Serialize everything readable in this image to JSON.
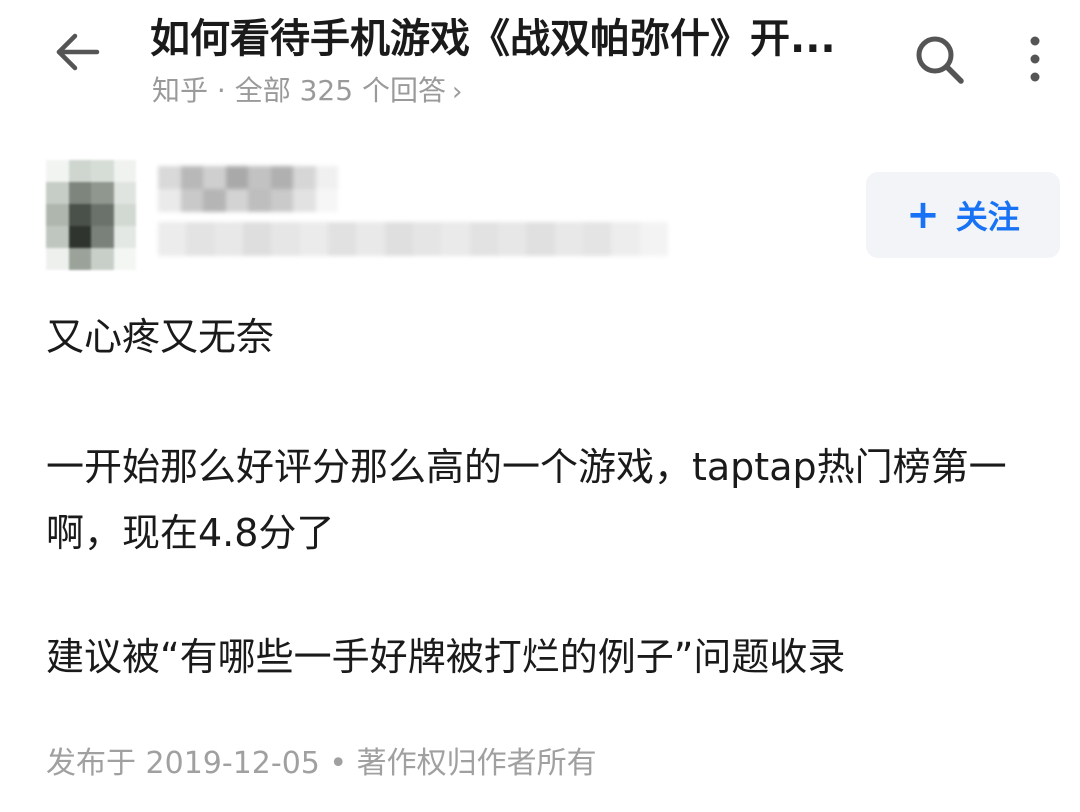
{
  "header": {
    "title": "如何看待手机游戏《战双帕弥什》开...",
    "subtitle": "知乎 · 全部 325 个回答",
    "subtitle_chevron": "›",
    "icons": {
      "back": "back-arrow-icon",
      "search": "search-icon",
      "more": "more-vertical-icon"
    }
  },
  "author": {
    "follow_plus": "+",
    "follow_label": "关注",
    "follow_color": "#1772f6"
  },
  "answer": {
    "paragraph1": "又心疼又无奈",
    "paragraph2": "一开始那么好评分那么高的一个游戏，taptap热门榜第一啊，现在4.8分了",
    "paragraph3": "建议被“有哪些一手好牌被打烂的例子”问题收录"
  },
  "footer": {
    "meta": "发布于 2019-12-05 • 著作权归作者所有"
  }
}
